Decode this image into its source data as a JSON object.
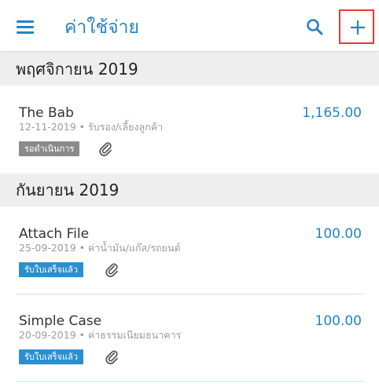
{
  "appbar": {
    "title": "ค่าใช้จ่าย",
    "icons": [
      "menu-icon",
      "search-icon",
      "add-icon"
    ]
  },
  "sections": [
    {
      "month": "พฤศจิกายน 2019",
      "items": [
        {
          "title": "The Bab",
          "amount": "1,165.00",
          "meta": "12-11-2019 • รับรอง/เลี้ยงลูกค้า",
          "status": "รอดำเนินการ",
          "status_color": "#8a8a8a",
          "attachment_icon": "paperclip-icon"
        }
      ]
    },
    {
      "month": "กันยายน 2019",
      "items": [
        {
          "title": "Attach File",
          "amount": "100.00",
          "meta": "25-09-2019 • ค่าน้ำมัน/แก๊ส/รถยนต์",
          "status": "รับใบเสร็จแล้ว",
          "status_color": "#2b8fce",
          "attachment_icon": "paperclip-icon"
        },
        {
          "title": "Simple Case",
          "amount": "100.00",
          "meta": "20-09-2019 • ค่าธรรมเนียมธนาคาร",
          "status": "รับใบเสร็จแล้ว",
          "status_color": "#2b8fce",
          "attachment_icon": "paperclip-icon"
        }
      ]
    }
  ],
  "colors": {
    "accent": "#2583c5",
    "section_bg": "#eeeeee",
    "highlight_border": "#e53935"
  }
}
